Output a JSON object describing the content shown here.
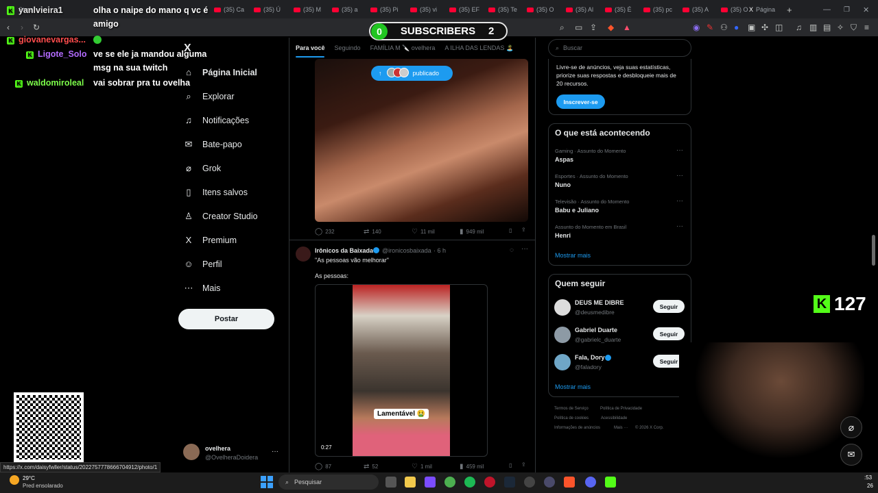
{
  "browser": {
    "tabs": [
      {
        "label": "Strea"
      },
      {
        "label": "(35) Ca"
      },
      {
        "label": "(35) Ú"
      },
      {
        "label": "(35) M"
      },
      {
        "label": "(35) a"
      },
      {
        "label": "(35) Pi"
      },
      {
        "label": "(35) vi"
      },
      {
        "label": "(35) EF"
      },
      {
        "label": "(35) Te"
      },
      {
        "label": "(35) O"
      },
      {
        "label": "(35) Al"
      },
      {
        "label": "(35) É"
      },
      {
        "label": "(35) pc"
      },
      {
        "label": "(35) A"
      },
      {
        "label": "(35) O"
      },
      {
        "label": "Página"
      }
    ],
    "new_tab": "+"
  },
  "overlay": {
    "subscribers_zero": "0",
    "subscribers_label": "SUBSCRIBERS",
    "subscribers_count": "2",
    "kick_count": "127",
    "chat": [
      {
        "user": "yanlvieira1",
        "message": "olha o naipe do mano q vc é",
        "message2": "amigo",
        "color": "#e6e6e6"
      },
      {
        "user": "giovanevargas...",
        "message": "",
        "color": "#ff4d4d"
      },
      {
        "user": "Ligote_Solo",
        "message": "ve se ele ja mandou alguma",
        "message2": "msg na sua twitch",
        "color": "#b36bff"
      },
      {
        "user": "waldomiroleal",
        "message": "vai sobrar pra tu ovelha",
        "color": "#7cfc4a"
      }
    ]
  },
  "nav": {
    "logo": "X",
    "items": [
      {
        "label": "Página Inicial",
        "icon": "home-icon"
      },
      {
        "label": "Explorar",
        "icon": "search-icon"
      },
      {
        "label": "Notificações",
        "icon": "bell-icon"
      },
      {
        "label": "Bate-papo",
        "icon": "mail-icon"
      },
      {
        "label": "Grok",
        "icon": "grok-icon"
      },
      {
        "label": "Itens salvos",
        "icon": "bookmark-icon"
      },
      {
        "label": "Creator Studio",
        "icon": "creator-icon"
      },
      {
        "label": "Premium",
        "icon": "x-icon"
      },
      {
        "label": "Perfil",
        "icon": "person-icon"
      },
      {
        "label": "Mais",
        "icon": "more-icon"
      }
    ],
    "post_label": "Postar",
    "account_name": "ovelhera",
    "account_handle": "@OvelheraDoidera",
    "account_more": "···"
  },
  "feed": {
    "tabs": [
      {
        "label": "Para você",
        "active": true
      },
      {
        "label": "Seguindo"
      },
      {
        "label": "FAMÍLIA M 🔪 ovelhera"
      },
      {
        "label": "A ILHA DAS LENDAS 🏝️"
      }
    ],
    "published_label": "publicado",
    "post1_stats": {
      "replies": "232",
      "reposts": "140",
      "likes": "11 mil",
      "views": "949 mil"
    },
    "post2": {
      "author": "Irônicos da Baixada",
      "handle": "@ironicosbaixada",
      "time": "· 6 h",
      "text1": "\"As pessoas vão melhorar\"",
      "text2": "As pessoas:",
      "video_caption": "Lamentável 🤮",
      "video_time": "0:27",
      "stats": {
        "replies": "87",
        "reposts": "52",
        "likes": "1 mil",
        "views": "459 mil"
      }
    }
  },
  "sidebar": {
    "search_placeholder": "Buscar",
    "premium_text": "Livre-se de anúncios, veja suas estatísticas, priorize suas respostas e desbloqueie mais de 20 recursos.",
    "premium_button": "Inscrever-se",
    "trends_title": "O que está acontecendo",
    "trends": [
      {
        "meta": "Gaming · Assunto do Momento",
        "name": "Aspas"
      },
      {
        "meta": "Esportes · Assunto do Momento",
        "name": "Nuno"
      },
      {
        "meta": "Televisão · Assunto do Momento",
        "name": "Babu e Juliano"
      },
      {
        "meta": "Assunto do Momento em Brasil",
        "name": "Henri"
      }
    ],
    "trends_more": "Mostrar mais",
    "follow_title": "Quem seguir",
    "follow": [
      {
        "name": "DEUS ME DIBRE",
        "handle": "@deusmedibre",
        "button": "Seguir"
      },
      {
        "name": "Gabriel Duarte",
        "handle": "@gabrielc_duarte",
        "button": "Seguir"
      },
      {
        "name": "Fala, Dory",
        "handle": "@faladory",
        "button": "Seguir"
      }
    ],
    "follow_more": "Mostrar mais",
    "footer": [
      "Termos de Serviço",
      "Política de Privacidade",
      "Política de cookies",
      "Acessibilidade",
      "Informações de anúncios",
      "Mais ···",
      "© 2026 X Corp."
    ]
  },
  "status": {
    "url": "https://x.com/daisyfwller/status/2022757778666704912/photo/1"
  },
  "taskbar": {
    "weather_temp": "29°C",
    "weather_desc": "Pred ensolarado",
    "search_placeholder": "Pesquisar",
    "clock": ":53",
    "date": "26"
  }
}
